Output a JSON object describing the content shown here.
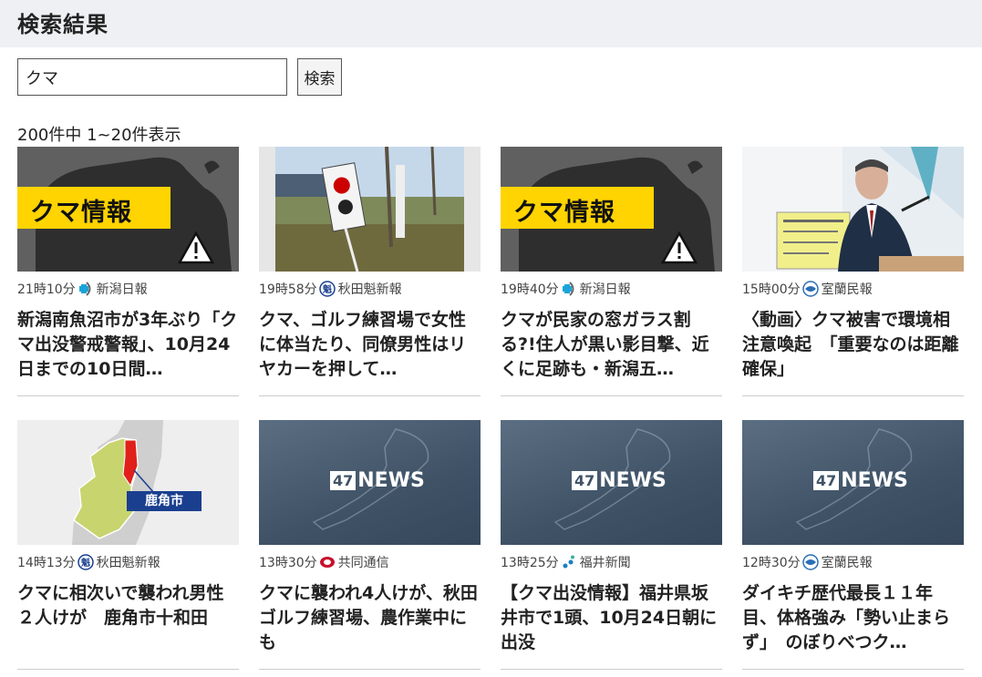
{
  "page_title": "検索結果",
  "search": {
    "value": "クマ",
    "button_label": "検索"
  },
  "result_count": "200件中 1~20件表示",
  "cards": [
    {
      "time": "21時10分",
      "source": "新潟日報",
      "source_icon": "niigata-nippo-logo",
      "title": "新潟南魚沼市が3年ぶり「クマ出没警戒警報」、10月24日までの10日間…",
      "thumb": "bear-info",
      "thumb_text": "クマ情報"
    },
    {
      "time": "19時58分",
      "source": "秋田魁新報",
      "source_icon": "akita-sakigake-logo",
      "title": "クマ、ゴルフ練習場で女性に体当たり、同僚男性はリヤカーを押して…",
      "thumb": "photo-field"
    },
    {
      "time": "19時40分",
      "source": "新潟日報",
      "source_icon": "niigata-nippo-logo",
      "title": "クマが民家の窓ガラス割る?!住人が黒い影目撃、近くに足跡も・新潟五…",
      "thumb": "bear-info",
      "thumb_text": "クマ情報"
    },
    {
      "time": "15時00分",
      "source": "室蘭民報",
      "source_icon": "muroran-minpo-logo",
      "title": "〈動画〉クマ被害で環境相注意喚起　「重要なのは距離確保」",
      "thumb": "photo-press"
    },
    {
      "time": "14時13分",
      "source": "秋田魁新報",
      "source_icon": "akita-sakigake-logo",
      "title": "クマに相次いで襲われ男性２人けが　鹿角市十和田",
      "thumb": "map-kazuno",
      "thumb_text": "鹿角市"
    },
    {
      "time": "13時30分",
      "source": "共同通信",
      "source_icon": "kyodo-logo",
      "title": "クマに襲われ4人けが、秋田　ゴルフ練習場、農作業中にも",
      "thumb": "news47",
      "thumb_num": "47",
      "thumb_word": "NEWS"
    },
    {
      "time": "13時25分",
      "source": "福井新聞",
      "source_icon": "fukui-shimbun-logo",
      "title": "【クマ出没情報】福井県坂井市で1頭、10月24日朝に出没",
      "thumb": "news47",
      "thumb_num": "47",
      "thumb_word": "NEWS"
    },
    {
      "time": "12時30分",
      "source": "室蘭民報",
      "source_icon": "muroran-minpo-logo",
      "title": "ダイキチ歴代最長１１年目、体格強み「勢い止まらず」　のぼりべつク…",
      "thumb": "news47",
      "thumb_num": "47",
      "thumb_word": "NEWS"
    }
  ],
  "colors": {
    "header_bg": "#eef0f3",
    "warning_yellow": "#ffd400",
    "news47_blue": "#3f5266",
    "map_red": "#e0201a",
    "map_label_blue": "#1a3f8f"
  }
}
